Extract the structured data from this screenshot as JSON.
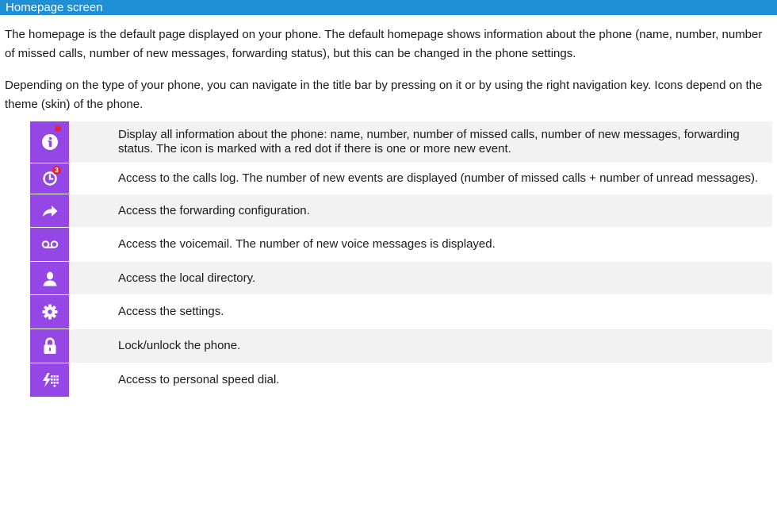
{
  "header": {
    "title": "Homepage screen"
  },
  "intro": {
    "p1": "The homepage is the default page displayed on your phone. The default homepage shows information about the phone (name, number, number of missed calls, number of new messages, forwarding status), but this can be changed in the phone settings.",
    "p2": "Depending on the type of your phone, you can navigate in the title bar by pressing on it or by using the right navigation key. Icons depend on the theme (skin) of the phone."
  },
  "icon_rows": [
    {
      "icon": "info-icon",
      "text": "Display all information about the phone: name, number, number of missed calls, number of new messages, forwarding status. The icon is marked with a red dot if there is one or more new event."
    },
    {
      "icon": "calls-log-icon",
      "badge": "3",
      "text": "Access to the calls log. The number of new events are displayed (number of missed calls + number of unread messages)."
    },
    {
      "icon": "forward-arrow-icon",
      "text": "Access the forwarding configuration."
    },
    {
      "icon": "voicemail-icon",
      "text": "Access the voicemail. The number of new voice messages is displayed."
    },
    {
      "icon": "person-icon",
      "text": "Access the local directory."
    },
    {
      "icon": "gear-icon",
      "text": "Access the settings."
    },
    {
      "icon": "lock-icon",
      "text": "Lock/unlock the phone."
    },
    {
      "icon": "speed-dial-icon",
      "text": "Access to personal speed dial."
    }
  ],
  "colors": {
    "header_bg": "#1f8fd6",
    "icon_bg": "#9547e6",
    "badge": "#e0263b",
    "row_shade": "#f2f2f2"
  }
}
